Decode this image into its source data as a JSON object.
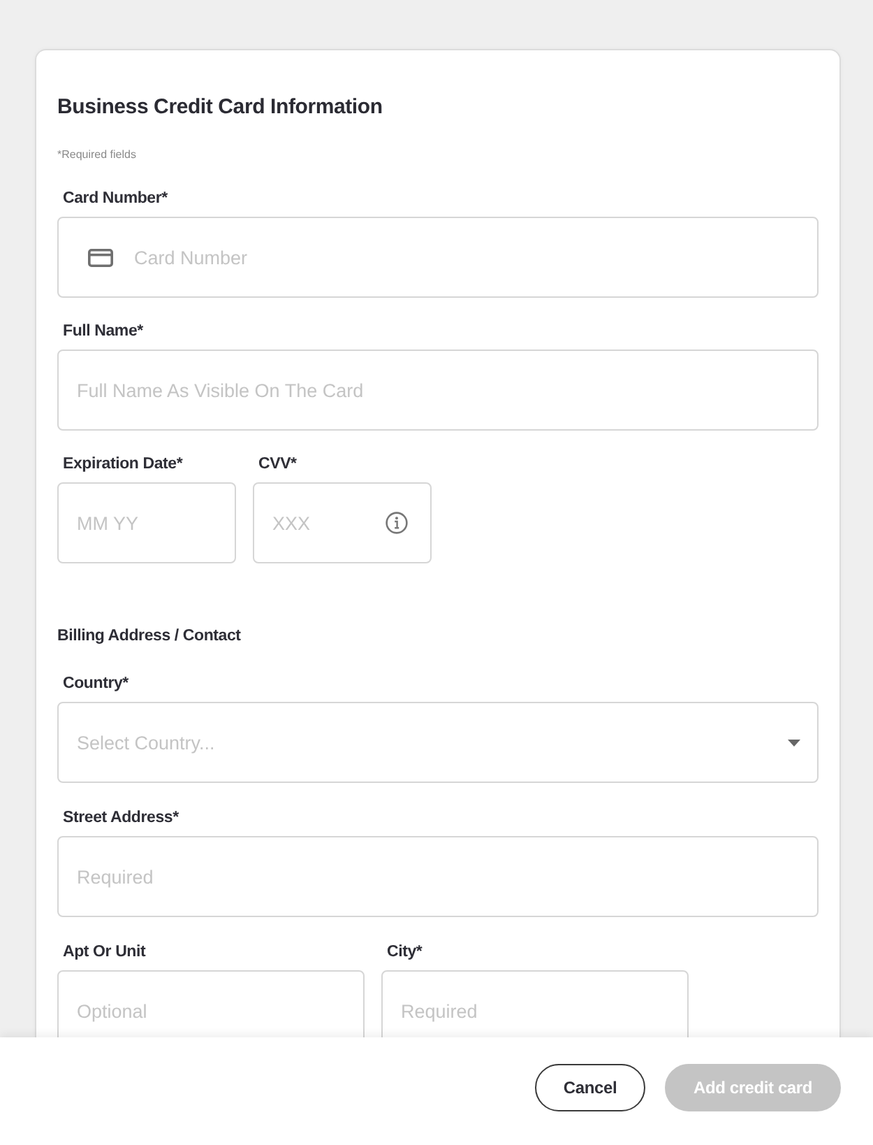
{
  "form": {
    "title": "Business Credit Card Information",
    "required_note": "*Required fields",
    "sections": [
      {
        "rows": [
          {
            "kind": "full",
            "fields": [
              {
                "kind": "card",
                "label": "Card Number*",
                "placeholder": "Card Number"
              }
            ]
          },
          {
            "kind": "full",
            "fields": [
              {
                "kind": "text",
                "label": "Full Name*",
                "placeholder": "Full Name As Visible On The Card"
              }
            ]
          },
          {
            "kind": "short",
            "fields": [
              {
                "kind": "text",
                "label": "Expiration Date*",
                "placeholder": "MM YY"
              },
              {
                "kind": "cvv",
                "label": "CVV*",
                "placeholder": "XXX"
              }
            ]
          }
        ]
      },
      {
        "heading": "Billing Address / Contact",
        "rows": [
          {
            "kind": "full",
            "fields": [
              {
                "kind": "select",
                "label": "Country*",
                "placeholder": "Select Country..."
              }
            ]
          },
          {
            "kind": "full",
            "fields": [
              {
                "kind": "text",
                "label": "Street Address*",
                "placeholder": "Required"
              }
            ]
          },
          {
            "kind": "half",
            "fields": [
              {
                "kind": "text",
                "label": "Apt Or Unit",
                "placeholder": "Optional"
              },
              {
                "kind": "text",
                "label": "City*",
                "placeholder": "Required"
              }
            ]
          }
        ]
      }
    ]
  },
  "footer": {
    "buttons": [
      {
        "kind": "secondary",
        "label": "Cancel",
        "disabled": false
      },
      {
        "kind": "primary",
        "label": "Add credit card",
        "disabled": true
      }
    ]
  }
}
